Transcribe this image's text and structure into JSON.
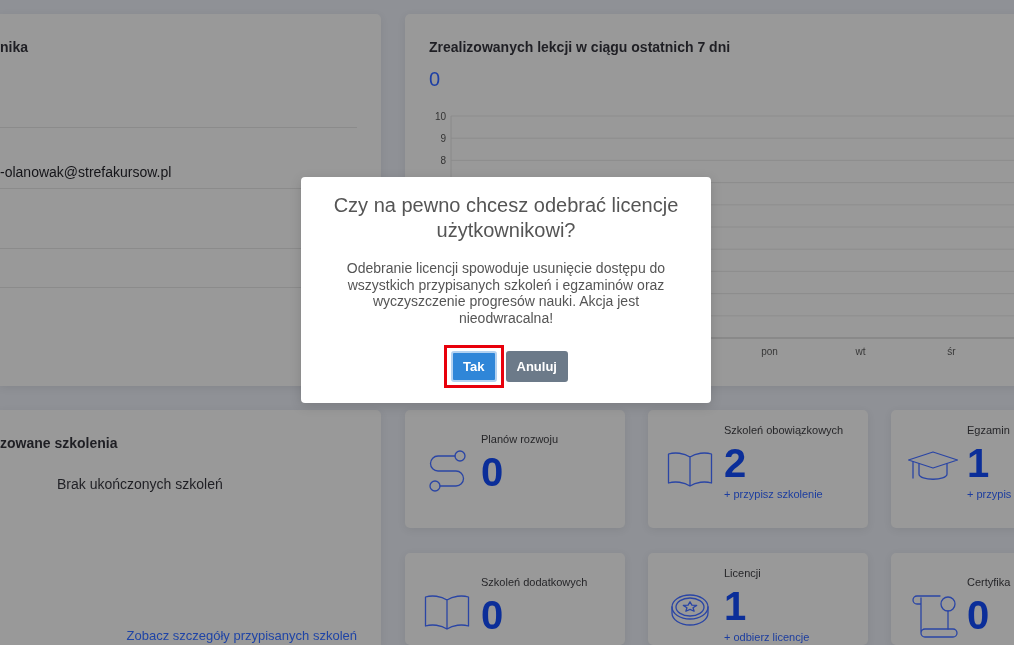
{
  "profile_card": {
    "title": "nika",
    "email": "-olanowak@strefakursow.pl"
  },
  "lessons_card": {
    "title": "Zrealizowanych lekcji w ciągu ostatnich 7 dni",
    "total": "0",
    "chart": {
      "y_labels": [
        "10",
        "9",
        "8"
      ],
      "x_labels": [
        "pon",
        "wt",
        "śr"
      ]
    }
  },
  "completed_card": {
    "title": "zowane szkolenia",
    "empty_message": "Brak ukończonych szkoleń",
    "link": "Zobacz szczegóły przypisanych szkoleń"
  },
  "stats": [
    {
      "kind": "plans",
      "label": "Planów rozwoju",
      "value": "0"
    },
    {
      "kind": "mandatory",
      "label": "Szkoleń obowiązkowych",
      "value": "2",
      "link": "+ przypisz szkolenie"
    },
    {
      "kind": "exams",
      "label": "Egzamin",
      "value": "1",
      "link": "+ przypis"
    },
    {
      "kind": "additional",
      "label": "Szkoleń dodatkowych",
      "value": "0"
    },
    {
      "kind": "licenses",
      "label": "Licencji",
      "value": "1",
      "link": "+ odbierz licencje"
    },
    {
      "kind": "certificates",
      "label": "Certyfika",
      "value": "0"
    }
  ],
  "dialog": {
    "title": "Czy na pewno chcesz odebrać licencje użytkownikowi?",
    "message": "Odebranie licencji spowoduje usunięcie dostępu do wszystkich przypisanych szkoleń i egzaminów oraz wyczyszczenie progresów nauki. Akcja jest nieodwracalna!",
    "buttons": [
      {
        "label": "Tak",
        "kind": "primary",
        "focused": true,
        "highlighted": true
      },
      {
        "label": "Anuluj",
        "kind": "secondary",
        "focused": false,
        "highlighted": false
      }
    ]
  }
}
